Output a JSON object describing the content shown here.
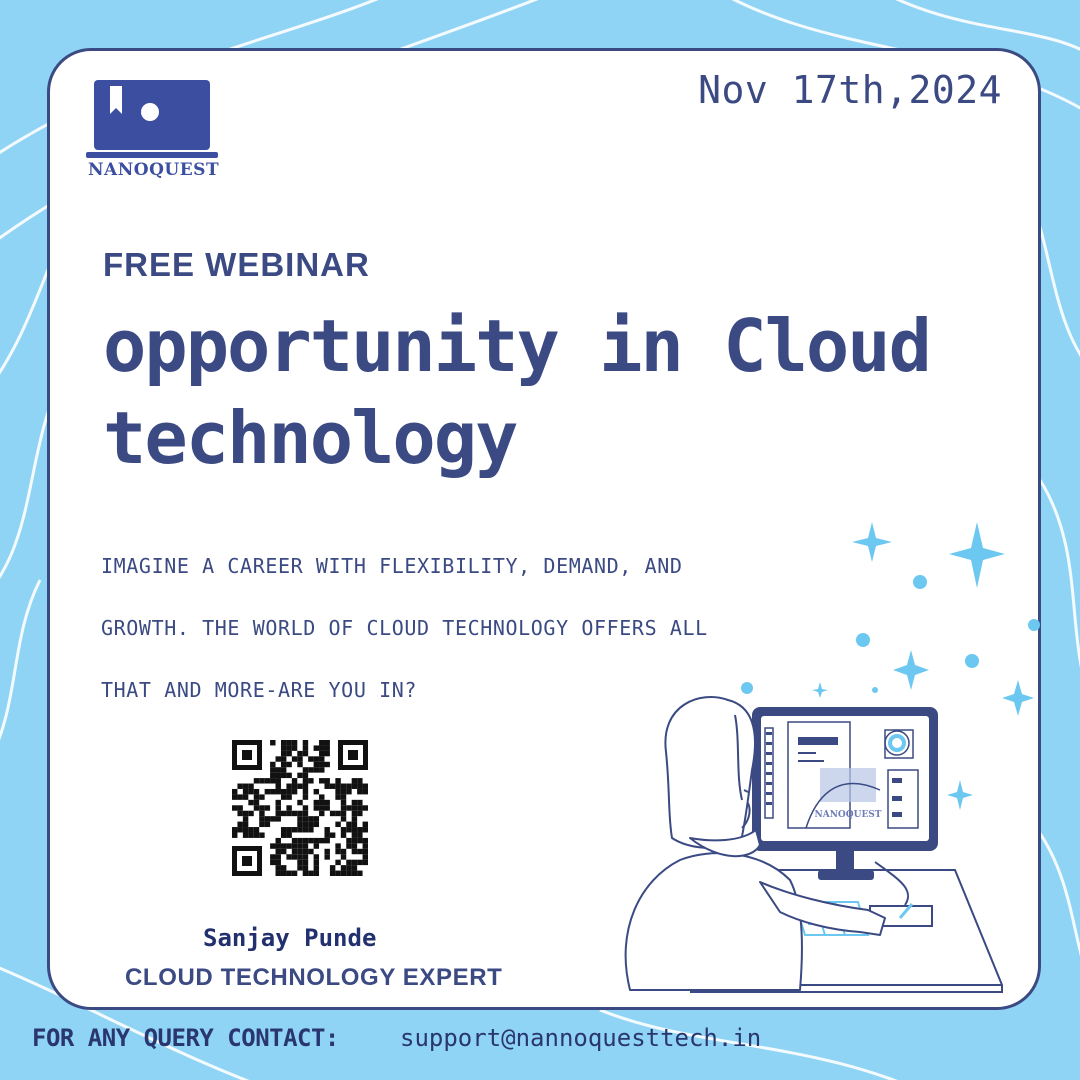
{
  "brand": {
    "name": "NANOQUEST",
    "logo_icon": "book-screen-icon"
  },
  "event": {
    "date": "Nov 17th,2024",
    "eyebrow": "FREE WEBINAR",
    "title_line_1": "opportunity in Cloud",
    "title_line_2": "technology",
    "description_lines": [
      "IMAGINE A CAREER WITH FLEXIBILITY, DEMAND, AND",
      "GROWTH. THE WORLD OF CLOUD TECHNOLOGY OFFERS ALL",
      "THAT AND MORE-ARE YOU IN?"
    ]
  },
  "qr_code": {
    "icon": "qr-code-icon"
  },
  "speaker": {
    "name": "Sanjay Punde",
    "role": "CLOUD TECHNOLOGY EXPERT"
  },
  "illustration": {
    "subject": "person-at-computer-illustration",
    "screen_logo_text": "NANOQUEST"
  },
  "footer": {
    "contact_label": "FOR ANY QUERY CONTACT:",
    "contact_email": "support@nannoquesttech.in"
  },
  "colors": {
    "background": "#8fd4f5",
    "navy": "#3b4a83",
    "accent_blue": "#8fd4f5",
    "sparkle": "#6cc8f0"
  }
}
